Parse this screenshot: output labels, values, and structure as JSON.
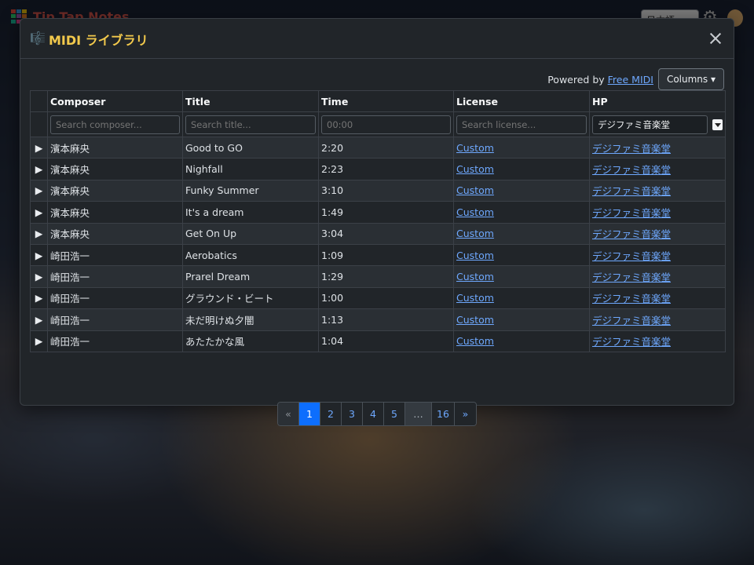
{
  "background_app": {
    "title": "Tip Tap Notes",
    "language_select": "日本語"
  },
  "modal": {
    "title": "MIDI ライブラリ",
    "powered_by_prefix": "Powered by ",
    "powered_by_link": "Free MIDI",
    "columns_button": "Columns ▾",
    "headers": [
      "Composer",
      "Title",
      "Time",
      "License",
      "HP"
    ],
    "filters": {
      "composer_placeholder": "Search composer...",
      "title_placeholder": "Search title...",
      "time_placeholder": "00:00",
      "license_placeholder": "Search license...",
      "hp_value": "デジファミ音楽堂"
    },
    "rows": [
      {
        "composer": "濱本麻央",
        "title": "Good to GO",
        "time": "2:20",
        "license": "Custom",
        "hp": "デジファミ音楽堂"
      },
      {
        "composer": "濱本麻央",
        "title": "Nighfall",
        "time": "2:23",
        "license": "Custom",
        "hp": "デジファミ音楽堂"
      },
      {
        "composer": "濱本麻央",
        "title": "Funky Summer",
        "time": "3:10",
        "license": "Custom",
        "hp": "デジファミ音楽堂"
      },
      {
        "composer": "濱本麻央",
        "title": "It's a dream",
        "time": "1:49",
        "license": "Custom",
        "hp": "デジファミ音楽堂"
      },
      {
        "composer": "濱本麻央",
        "title": "Get On Up",
        "time": "3:04",
        "license": "Custom",
        "hp": "デジファミ音楽堂"
      },
      {
        "composer": "崎田浩一",
        "title": "Aerobatics",
        "time": "1:09",
        "license": "Custom",
        "hp": "デジファミ音楽堂"
      },
      {
        "composer": "崎田浩一",
        "title": "Prarel Dream",
        "time": "1:29",
        "license": "Custom",
        "hp": "デジファミ音楽堂"
      },
      {
        "composer": "崎田浩一",
        "title": "グラウンド・ビート",
        "time": "1:00",
        "license": "Custom",
        "hp": "デジファミ音楽堂"
      },
      {
        "composer": "崎田浩一",
        "title": "未だ明けぬ夕闇",
        "time": "1:13",
        "license": "Custom",
        "hp": "デジファミ音楽堂"
      },
      {
        "composer": "崎田浩一",
        "title": "あたたかな風",
        "time": "1:04",
        "license": "Custom",
        "hp": "デジファミ音楽堂"
      }
    ],
    "pagination": [
      "«",
      "1",
      "2",
      "3",
      "4",
      "5",
      "…",
      "16",
      "»"
    ],
    "active_page": "1"
  },
  "colors": {
    "accent_title": "#f2c94c",
    "link": "#6ea8fe",
    "active_page": "#0d6efd"
  }
}
